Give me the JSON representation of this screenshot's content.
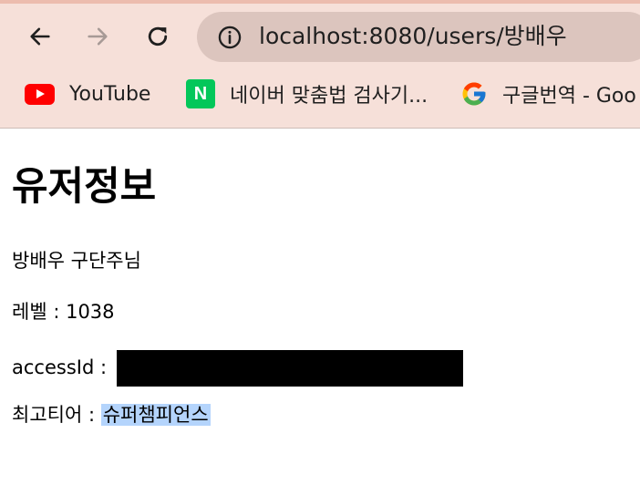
{
  "browser": {
    "url": "localhost:8080/users/방배우",
    "bookmarks": [
      {
        "label": "YouTube",
        "icon": "youtube-icon"
      },
      {
        "label": "네이버 맞춤법 검사기...",
        "icon": "naver-icon"
      },
      {
        "label": "구글번역 - Goo",
        "icon": "google-icon"
      }
    ],
    "naver_letter": "N"
  },
  "page": {
    "title": "유저정보",
    "name_line": "방배우 구단주님",
    "level_label": "레벨 : ",
    "level_value": "1038",
    "access_label": "accessId : ",
    "tier_label": "최고티어 : ",
    "tier_value": "슈퍼챔피언스"
  },
  "colors": {
    "chrome_bg": "#f6e0d9",
    "omnibox_bg": "#dcc5be",
    "highlight": "#b4d4fc",
    "redaction": "#000000"
  }
}
